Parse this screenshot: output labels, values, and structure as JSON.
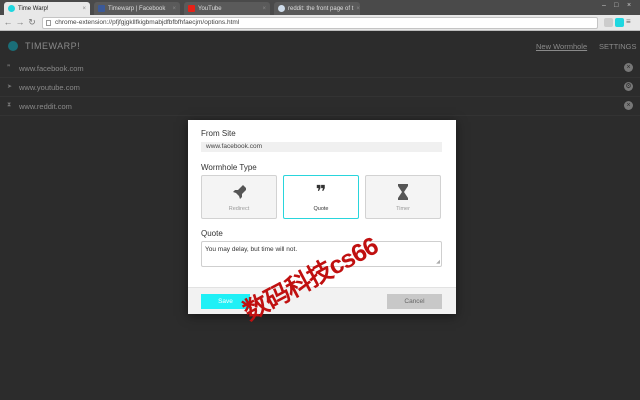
{
  "browser": {
    "tabs": [
      {
        "title": "Time Warp!",
        "favicon_color": "#1fd7e0",
        "active": true
      },
      {
        "title": "Timewarp | Facebook",
        "favicon_color": "#3b5998",
        "active": false
      },
      {
        "title": "YouTube",
        "favicon_color": "#e62117",
        "active": false
      },
      {
        "title": "reddit: the front page of t",
        "favicon_color": "#cfdcea",
        "active": false
      }
    ],
    "tab_close": "×",
    "back": "←",
    "forward": "→",
    "reload": "↻",
    "url": "chrome-extension://pfjfgjgkllfkigbmabjdfbfbfhfaecjm/options.html",
    "menu": "≡",
    "ext_colors": [
      "#cccccc",
      "#1fd7e0"
    ]
  },
  "app": {
    "title": "TIMEWARP!",
    "nav": {
      "new_wormhole": "New Wormhole",
      "settings": "SETTINGS"
    },
    "sites": [
      {
        "icon": "quote-icon",
        "glyph": "❞",
        "url": "www.facebook.com",
        "action_icon": "close-icon",
        "action_glyph": "×"
      },
      {
        "icon": "redirect-icon",
        "glyph": "➤",
        "url": "www.youtube.com",
        "action_icon": "gear-icon",
        "action_glyph": "⚙"
      },
      {
        "icon": "timer-icon",
        "glyph": "⧗",
        "url": "www.reddit.com",
        "action_icon": "close-icon",
        "action_glyph": "×"
      }
    ]
  },
  "modal": {
    "from_site_label": "From Site",
    "from_site_value": "www.facebook.com",
    "wormhole_type_label": "Wormhole Type",
    "types": [
      {
        "label": "Redirect",
        "icon": "rocket-icon",
        "glyph": "🚀",
        "selected": false
      },
      {
        "label": "Quote",
        "icon": "quote-icon",
        "glyph": "❞",
        "selected": true
      },
      {
        "label": "Timer",
        "icon": "hourglass-icon",
        "glyph": "⧗",
        "selected": false
      }
    ],
    "quote_label": "Quote",
    "quote_value": "You may delay, but time will not.",
    "save_label": "Save",
    "cancel_label": "Cancel"
  },
  "watermark": "数码科技cs66",
  "colors": {
    "accent": "#1ff0f6",
    "overlay": "#2c2c2c",
    "modal_bg": "#ffffff"
  }
}
